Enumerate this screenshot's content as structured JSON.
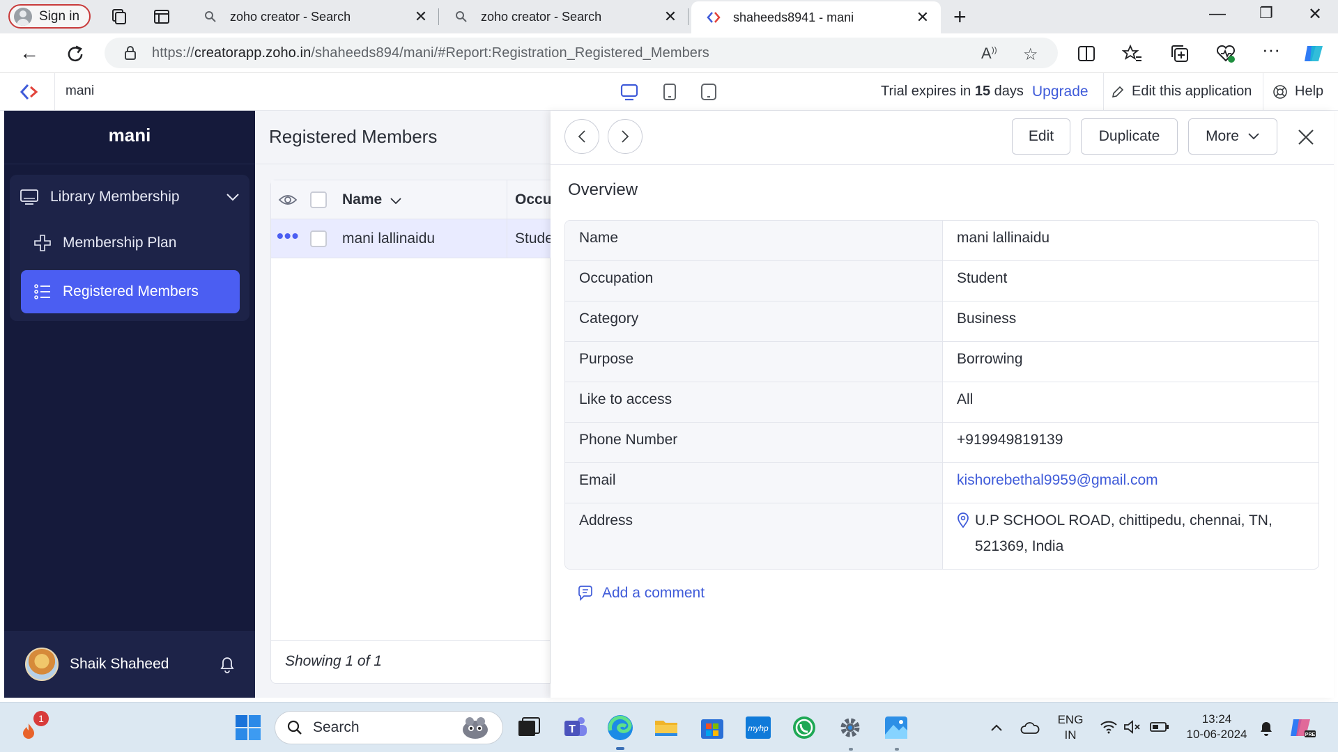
{
  "browser": {
    "signin_label": "Sign in",
    "tabs": [
      {
        "title": "zoho creator - Search"
      },
      {
        "title": "zoho creator - Search"
      },
      {
        "title": "shaheeds8941 - mani"
      }
    ],
    "url_prefix": "https://",
    "url_host": "creatorapp.zoho.in",
    "url_path": "/shaheeds894/mani/#Report:Registration_Registered_Members"
  },
  "app_header": {
    "app_name": "mani",
    "trial_prefix": "Trial expires in",
    "trial_days": "15",
    "trial_suffix": "days",
    "upgrade_label": "Upgrade",
    "edit_app_label": "Edit this application",
    "help_label": "Help"
  },
  "sidebar": {
    "title": "mani",
    "group_label": "Library Membership",
    "items": [
      {
        "label": "Membership Plan"
      },
      {
        "label": "Registered Members"
      }
    ],
    "user_name": "Shaik Shaheed"
  },
  "report": {
    "title": "Registered Members",
    "columns": [
      "Name",
      "Occu"
    ],
    "rows": [
      {
        "name": "mani lallinaidu",
        "occupation": "Stude"
      }
    ],
    "footer": "Showing 1 of 1"
  },
  "detail": {
    "buttons": {
      "edit": "Edit",
      "duplicate": "Duplicate",
      "more": "More"
    },
    "section_title": "Overview",
    "fields": [
      {
        "label": "Name",
        "value": "mani lallinaidu"
      },
      {
        "label": "Occupation",
        "value": "Student"
      },
      {
        "label": "Category",
        "value": "Business"
      },
      {
        "label": "Purpose",
        "value": "Borrowing"
      },
      {
        "label": "Like to access",
        "value": "All"
      },
      {
        "label": "Phone Number",
        "value": "+919949819139"
      },
      {
        "label": "Email",
        "value": "kishorebethal9959@gmail.com"
      },
      {
        "label": "Address",
        "value": "U.P SCHOOL ROAD, chittipedu, chennai, TN, 521369, India"
      }
    ],
    "add_comment_label": "Add a comment"
  },
  "taskbar": {
    "notification_count": "1",
    "search_placeholder": "Search",
    "lang_line1": "ENG",
    "lang_line2": "IN",
    "time": "13:24",
    "date": "10-06-2024"
  },
  "colors": {
    "sidebar_bg": "#151a3b",
    "accent": "#4b5ef2",
    "link": "#3f5bd9"
  }
}
